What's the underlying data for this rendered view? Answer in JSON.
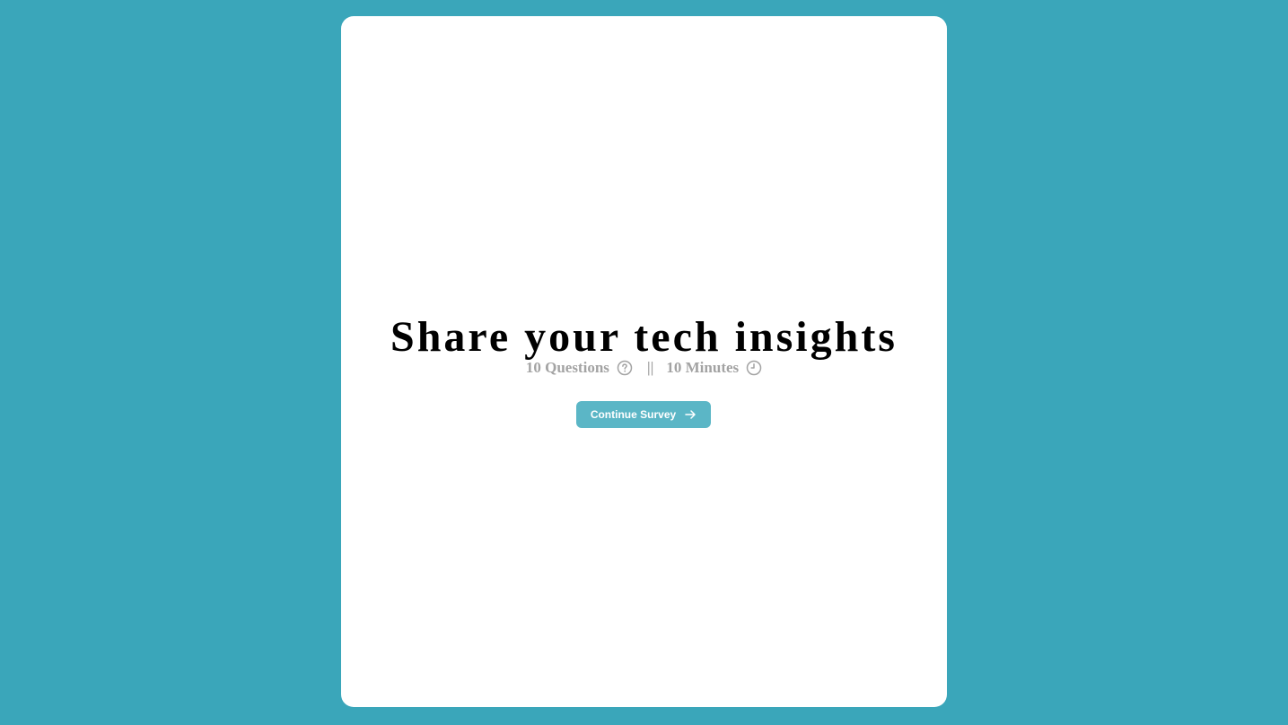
{
  "survey": {
    "title": "Share your tech insights",
    "questions_label": "10 Questions",
    "separator": "||",
    "minutes_label": "10 Minutes",
    "continue_label": "Continue Survey"
  },
  "icons": {
    "questions": "question-circle-icon",
    "minutes": "clock-icon",
    "continue": "arrow-right-icon"
  },
  "colors": {
    "background": "#3aa6ba",
    "card": "#ffffff",
    "button": "#5bb6c6",
    "meta_text": "#a3a3a3",
    "title_text": "#000000"
  }
}
